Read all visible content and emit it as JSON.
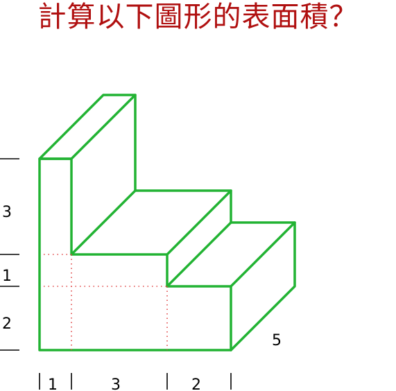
{
  "title": "計算以下圖形的表面積？",
  "colors": {
    "title": "#b01010",
    "solid_edge": "#22b333",
    "hidden_guide": "#e04040",
    "dimension": "#000000",
    "background": "#ffffff"
  },
  "dimensions": {
    "height_top": "3",
    "height_middle": "1",
    "height_bottom": "2",
    "width_left": "1",
    "width_middle": "3",
    "width_right": "2",
    "depth": "5"
  }
}
